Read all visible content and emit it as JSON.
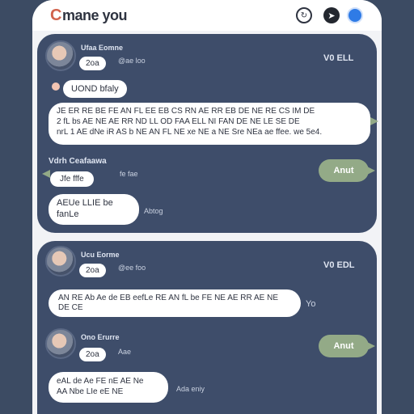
{
  "app": {
    "brand": "mane you"
  },
  "header_icons": [
    "refresh-icon",
    "compass-icon",
    "profile-icon"
  ],
  "colors": {
    "background": "#3c4b63",
    "card": "#3e4d6a",
    "accent": "#93aa87",
    "brand_swirl": "#d1634d"
  },
  "card1": {
    "author": "Ufaa Eomne",
    "handle": "@ae loo",
    "badge": "2oa",
    "side_label": "V0 ELL",
    "pill": "UOND bfaly",
    "message_line1": "JE ER RE BE FE AN FL EE EB CS RN AE RR EB DE NE RE CS IM DE",
    "message_line2": "2 fL bs AE NE AE RR ND LL OD FAA ELL NI FAN DE NE LE SE DE",
    "message_line3": "nrL 1 AE dNe iR AS b NE AN FL NE xe NE a NE Sre NEa ae ffee. we  5e4.",
    "second_author": "Vdrh Ceafaawa",
    "second_handle": "fe fae",
    "second_badge": "Jfe fffe",
    "reply_label": "Anut",
    "short_message": "AEUe LLIE be fanLe",
    "short_meta": "Abtog"
  },
  "card2": {
    "author": "Ucu Eorme",
    "handle": "@ee foo",
    "badge": "2oa",
    "side_label": "V0 EDL",
    "message": "AN RE Ab Ae de EB eefLe RE AN fL be FE NE AE RR AE NE DE CE",
    "side_meta": "Yo",
    "reply_label": "Anut",
    "second_author": "Ono Erurre",
    "second_handle": "Aae",
    "second_badge": "2oa",
    "short_message_line1": "eAL de Ae FE nE AE Ne",
    "short_message_line2": "AA Nbe LIe eE NE",
    "short_meta": "Ada eniy"
  }
}
